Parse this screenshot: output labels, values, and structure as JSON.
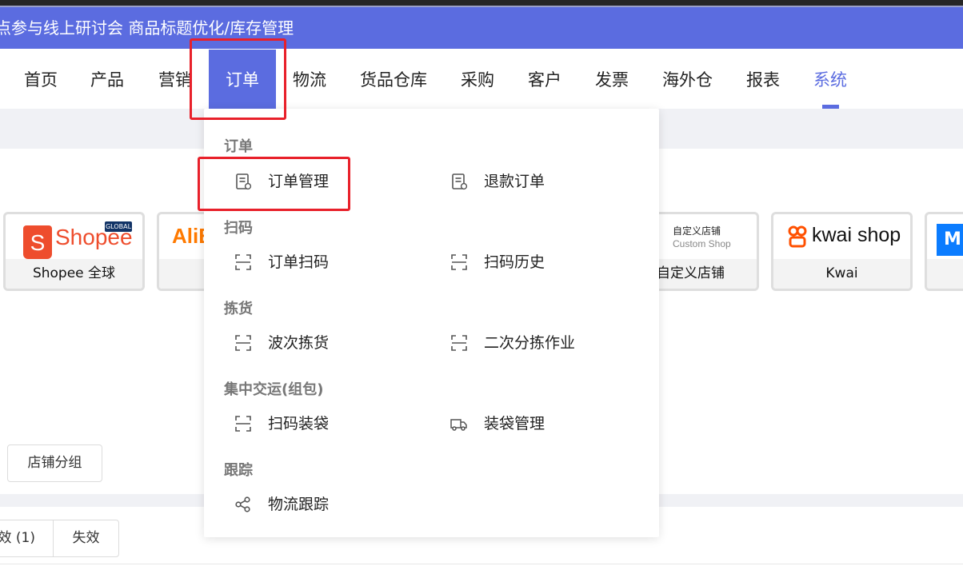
{
  "banner": {
    "text": "点参与线上研讨会 商品标题优化/库存管理"
  },
  "nav": {
    "items": [
      {
        "label": "首页"
      },
      {
        "label": "产品"
      },
      {
        "label": "营销"
      },
      {
        "label": "订单"
      },
      {
        "label": "物流"
      },
      {
        "label": "货品仓库"
      },
      {
        "label": "采购"
      },
      {
        "label": "客户"
      },
      {
        "label": "发票"
      },
      {
        "label": "海外仓"
      },
      {
        "label": "报表"
      },
      {
        "label": "系统"
      }
    ],
    "active": "订单",
    "accent_color": "#5b6ce0"
  },
  "stores": {
    "cards": [
      {
        "name": "Shopee 全球",
        "logo_text": "Shopee",
        "badge": "GLOBAL",
        "icon": "shopee-bag-icon"
      },
      {
        "name": "",
        "logo_text": "AliE",
        "icon": "aliexpress-logo"
      },
      {
        "name": "自定义店铺",
        "logo_line1": "自定义店铺",
        "logo_line2": "Custom Shop"
      },
      {
        "name": "Kwai",
        "logo_text": "kwai shop",
        "icon": "kwai-logo-icon"
      },
      {
        "name": "",
        "logo_text": "M",
        "icon": "blue-logo"
      }
    ],
    "group_button": "店铺分组"
  },
  "status_tabs": [
    {
      "label": "效 (1)"
    },
    {
      "label": "失效"
    }
  ],
  "dropdown": {
    "sections": [
      {
        "title": "订单",
        "items": [
          {
            "label": "订单管理",
            "icon": "order-doc-icon"
          },
          {
            "label": "退款订单",
            "icon": "order-doc-icon"
          }
        ]
      },
      {
        "title": "扫码",
        "items": [
          {
            "label": "订单扫码",
            "icon": "scan-icon"
          },
          {
            "label": "扫码历史",
            "icon": "scan-icon"
          }
        ]
      },
      {
        "title": "拣货",
        "items": [
          {
            "label": "波次拣货",
            "icon": "scan-icon"
          },
          {
            "label": "二次分拣作业",
            "icon": "scan-icon"
          }
        ]
      },
      {
        "title": "集中交运(组包)",
        "items": [
          {
            "label": "扫码装袋",
            "icon": "scan-icon"
          },
          {
            "label": "装袋管理",
            "icon": "truck-icon"
          }
        ]
      },
      {
        "title": "跟踪",
        "items": [
          {
            "label": "物流跟踪",
            "icon": "share-icon"
          }
        ]
      }
    ],
    "highlight_color": "#e8202a"
  }
}
